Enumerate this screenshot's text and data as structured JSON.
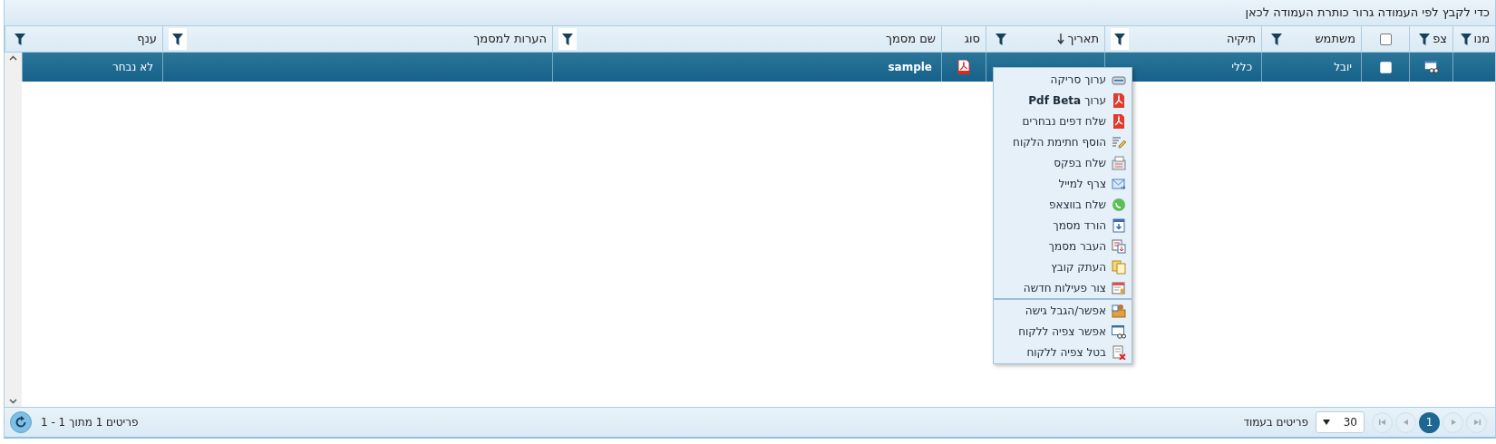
{
  "group_bar": {
    "hint": "כדי לקבץ לפי העמודה גרור כותרת העמודה לכאן"
  },
  "table": {
    "columns": [
      {
        "label": "מנו",
        "kind": "text",
        "filter": true
      },
      {
        "label": "צפ",
        "kind": "text",
        "filter": true
      },
      {
        "kind": "checkbox",
        "checked": false,
        "filter": false
      },
      {
        "label": "משתמש",
        "kind": "text",
        "filter": true
      },
      {
        "label": "תיקיה",
        "kind": "text",
        "filter": true
      },
      {
        "label": "תאריך",
        "kind": "text",
        "sorted": true,
        "filter": true
      },
      {
        "label": "סוג",
        "kind": "text",
        "filter": false
      },
      {
        "label": "שם מסמך",
        "kind": "text",
        "filter": true
      },
      {
        "label": "הערות למסמך",
        "kind": "text",
        "filter": true
      },
      {
        "label": "ענף",
        "kind": "text",
        "filter": true
      }
    ],
    "rows": [
      {
        "selected": true,
        "cells": [
          {
            "kind": "empty"
          },
          {
            "kind": "preview"
          },
          {
            "kind": "checkbox",
            "checked": false
          },
          {
            "kind": "text",
            "text": "יובל"
          },
          {
            "kind": "text",
            "text": "כללי"
          },
          {
            "kind": "empty"
          },
          {
            "kind": "pdf"
          },
          {
            "kind": "strong",
            "text": "sample"
          },
          {
            "kind": "empty"
          },
          {
            "kind": "text",
            "text": "לא נבחר"
          }
        ]
      }
    ]
  },
  "context_menu": {
    "items": [
      {
        "label": "ערוך סריקה",
        "separator_before": false
      },
      {
        "label": "ערוך **Pdf Beta**",
        "separator_before": false
      },
      {
        "label": "שלח דפים נבחרים",
        "separator_before": false
      },
      {
        "label": "הוסף חתימת הלקוח",
        "separator_before": false
      },
      {
        "label": "שלח בפקס",
        "separator_before": false
      },
      {
        "label": "צרף למייל",
        "separator_before": false
      },
      {
        "label": "שלח בווצאפ",
        "separator_before": false
      },
      {
        "label": "הורד מסמך",
        "separator_before": false
      },
      {
        "label": "העבר מסמך",
        "separator_before": false
      },
      {
        "label": "העתק קובץ",
        "separator_before": false
      },
      {
        "label": "צור פעילות חדשה",
        "separator_before": false
      },
      {
        "label": "אפשר/הגבל גישה",
        "separator_before": true
      },
      {
        "label": "אפשר צפיה ללקוח",
        "separator_before": false
      },
      {
        "label": "בטל צפיה ללקוח",
        "separator_before": false
      }
    ]
  },
  "pager": {
    "buttons": [
      {
        "kind": "last",
        "selected": false
      },
      {
        "kind": "next",
        "selected": false
      },
      {
        "kind": "page",
        "label": "1",
        "selected": true
      },
      {
        "kind": "prev",
        "selected": false
      },
      {
        "kind": "first",
        "selected": false
      }
    ],
    "page_size": "30",
    "page_size_label": "פריטים בעמוד",
    "summary": "פריטים 1 מתוך 1 - 1"
  }
}
